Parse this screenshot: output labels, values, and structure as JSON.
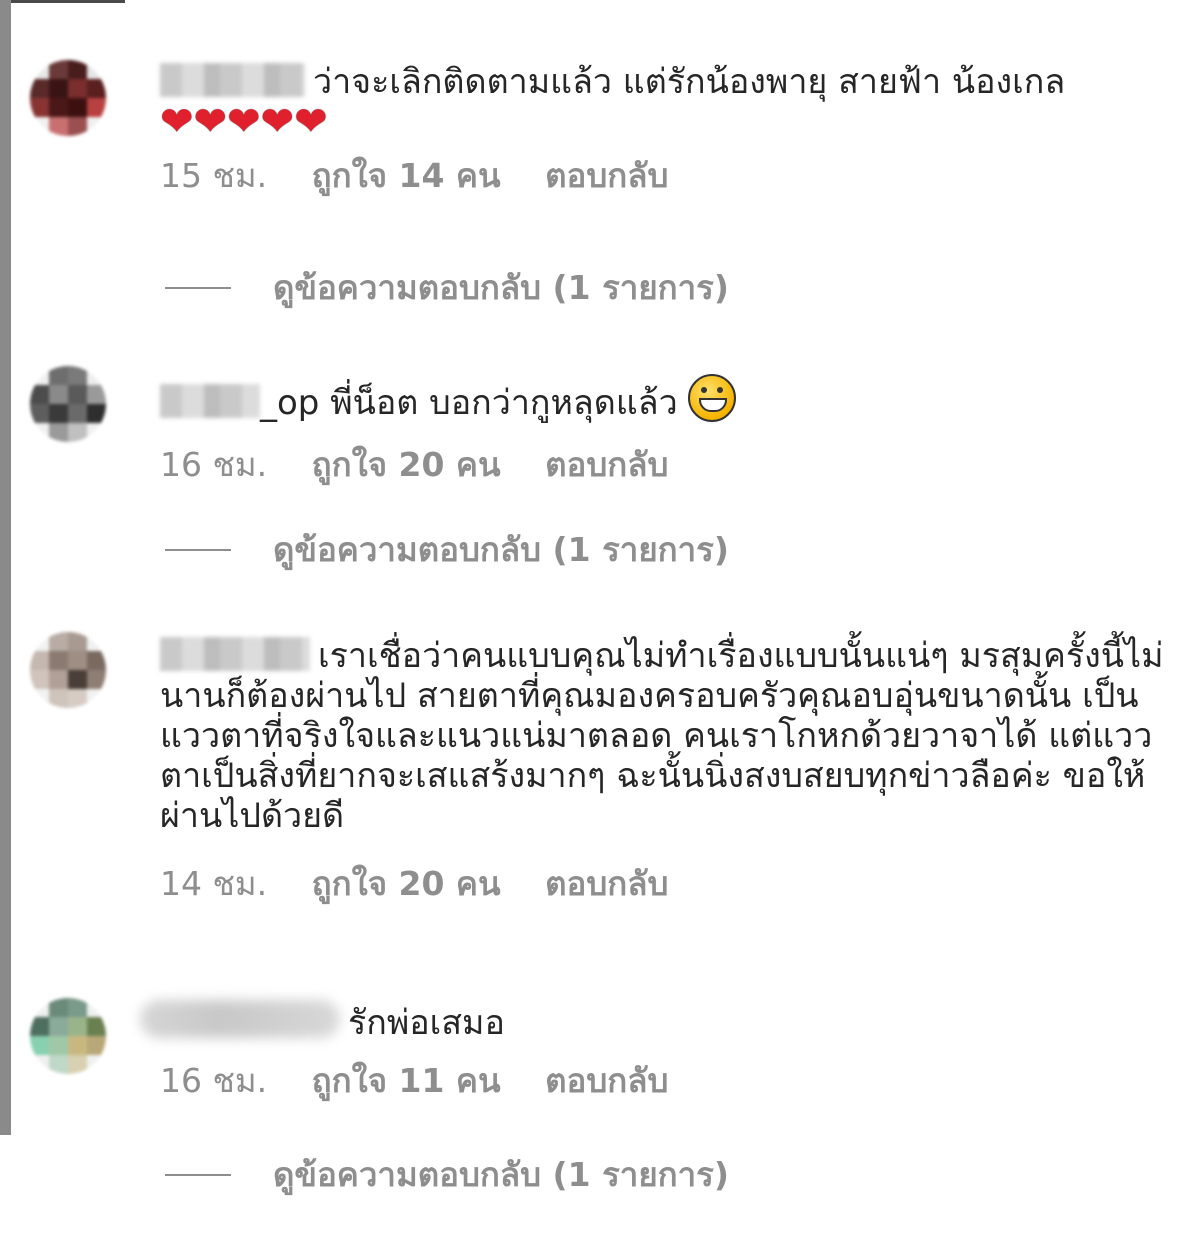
{
  "comments": [
    {
      "text": "ว่าจะเลิกติดตามแล้ว แต่รักน้องพายุ สายฟ้า น้องเกล",
      "hearts": "❤❤❤❤❤",
      "time": "15 ชม.",
      "likes": "ถูกใจ 14 คน",
      "reply": "ตอบกลับ",
      "view_replies": "ดูข้อความตอบกลับ (1 รายการ)"
    },
    {
      "username_suffix": "_op",
      "text": "พี่น็อต บอกว่ากูหลุดแล้ว",
      "emoji": "grinning-face-emoji",
      "time": "16 ชม.",
      "likes": "ถูกใจ 20 คน",
      "reply": "ตอบกลับ",
      "view_replies": "ดูข้อความตอบกลับ (1 รายการ)"
    },
    {
      "text": "เราเชื่อว่าคนแบบคุณไม่ทำเรื่องแบบนั้นแน่ๆ มรสุมครั้งนี้ไม่นานก็ต้องผ่านไป สายตาที่คุณมองครอบครัวคุณอบอุ่นขนาดนั้น เป็นแววตาที่จริงใจและแนวแน่มาตลอด คนเราโกหกด้วยวาจาได้ แต่แววตาเป็นสิ่งที่ยากจะเสแสร้งมากๆ ฉะนั้นนิ่งสงบสยบทุกข่าวลือค่ะ ขอให้ผ่านไปด้วยดี",
      "time": "14 ชม.",
      "likes": "ถูกใจ 20 คน",
      "reply": "ตอบกลับ"
    },
    {
      "text": "รักพ่อเสมอ",
      "time": "16 ชม.",
      "likes": "ถูกใจ 11 คน",
      "reply": "ตอบกลับ",
      "view_replies": "ดูข้อความตอบกลับ (1 รายการ)"
    }
  ],
  "colors": {
    "text": "#262626",
    "meta": "#8e8e8e",
    "heart": "#e0202d",
    "border": "#8a8a8a"
  }
}
